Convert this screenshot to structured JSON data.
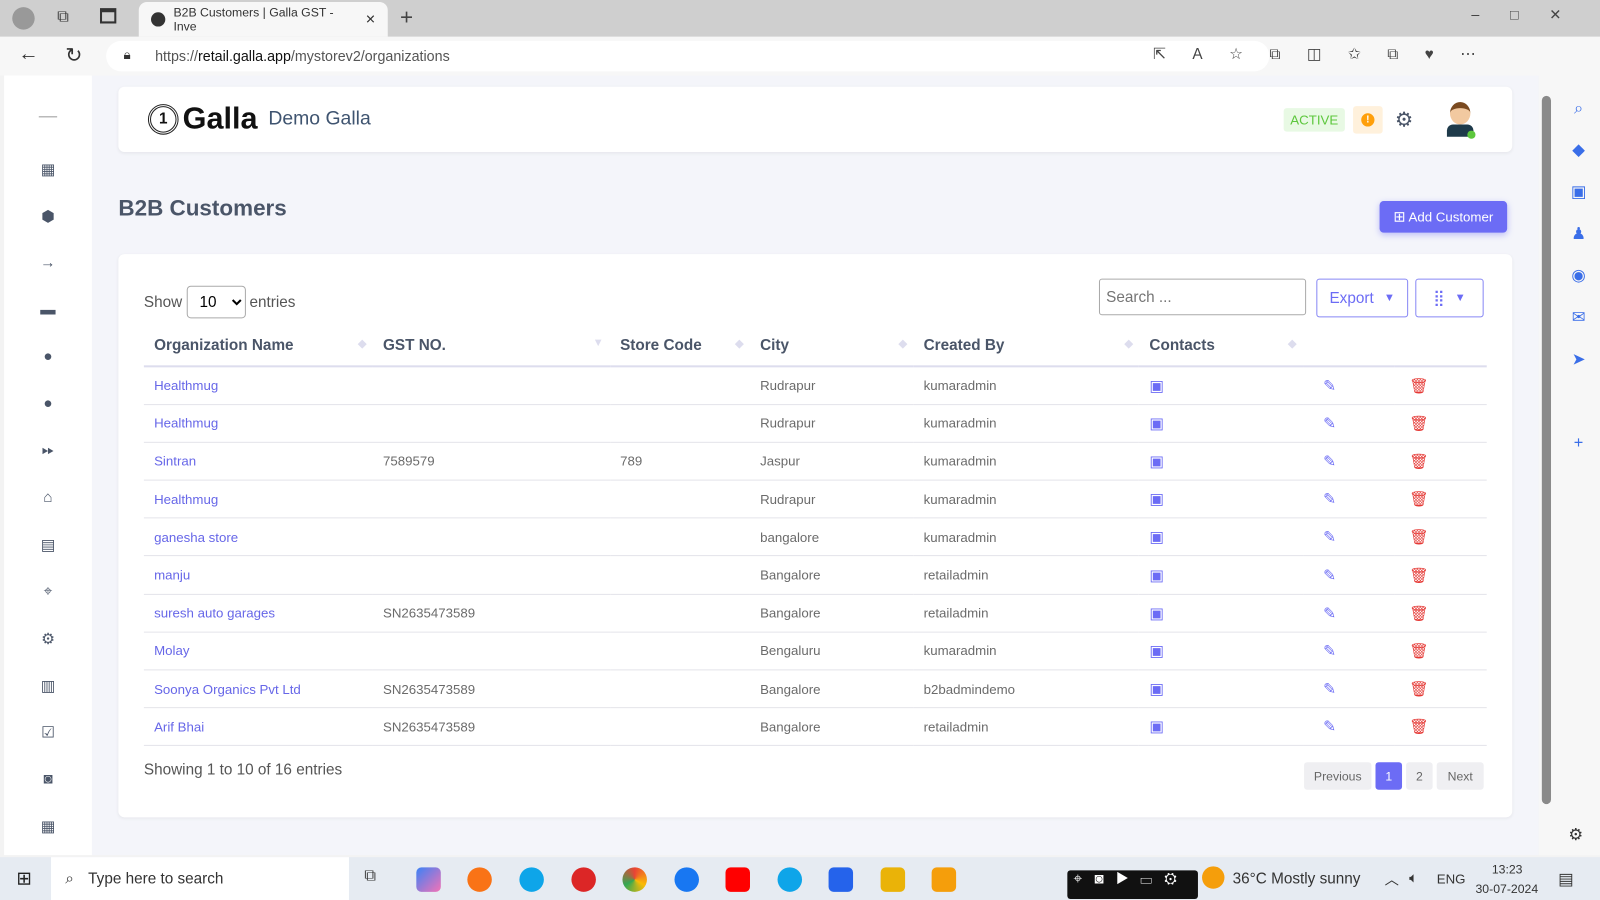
{
  "browser": {
    "tab_title": "B2B Customers | Galla GST - Inve",
    "url_prefix": "https://",
    "url_host": "retail.galla.app",
    "url_path": "/mystorev2/organizations"
  },
  "header": {
    "logo": "Galla",
    "store_name": "Demo Galla",
    "status": "ACTIVE",
    "warning": "!"
  },
  "page": {
    "title": "B2B Customers",
    "add_button": "Add Customer"
  },
  "controls": {
    "show": "Show",
    "entries": "entries",
    "page_size": "10",
    "search_placeholder": "Search ...",
    "export": "Export"
  },
  "table": {
    "columns": [
      "Organization Name",
      "GST NO.",
      "Store Code",
      "City",
      "Created By",
      "Contacts"
    ],
    "rows": [
      [
        "Healthmug",
        "",
        "",
        "Rudrapur",
        "kumaradmin"
      ],
      [
        "Healthmug",
        "",
        "",
        "Rudrapur",
        "kumaradmin"
      ],
      [
        "Sintran",
        "7589579",
        "789",
        "Jaspur",
        "kumaradmin"
      ],
      [
        "Healthmug",
        "",
        "",
        "Rudrapur",
        "kumaradmin"
      ],
      [
        "ganesha store",
        "",
        "",
        "bangalore",
        "kumaradmin"
      ],
      [
        "manju",
        "",
        "",
        "Bangalore",
        "retailadmin"
      ],
      [
        "suresh auto garages",
        "SN2635473589",
        "",
        "Bangalore",
        "retailadmin"
      ],
      [
        "Molay",
        "",
        "",
        "Bengaluru",
        "kumaradmin"
      ],
      [
        "Soonya Organics Pvt Ltd",
        "SN2635473589",
        "",
        "Bangalore",
        "b2badmindemo"
      ],
      [
        "Arif Bhai",
        "SN2635473589",
        "",
        "Bangalore",
        "retailadmin"
      ]
    ]
  },
  "footer": {
    "info": "Showing 1 to 10 of 16 entries",
    "previous": "Previous",
    "pages": [
      "1",
      "2"
    ],
    "current_page": "1",
    "next": "Next"
  },
  "taskbar": {
    "search": "Type here to search",
    "weather": "36°C  Mostly sunny",
    "lang": "ENG",
    "time": "13:23",
    "date": "30-07-2024"
  },
  "colors": {
    "accent": "#6c6cf5",
    "link": "#6767e8",
    "delete": "#e53935",
    "active": "#5dc73d"
  }
}
